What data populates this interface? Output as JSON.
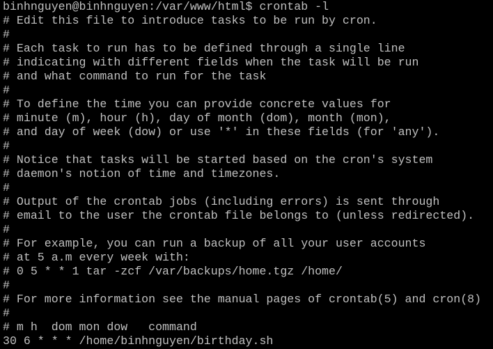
{
  "colors": {
    "background": "#000000",
    "text": "#c0c0c0"
  },
  "terminal": {
    "prompt": "binhnguyen@binhnguyen:/var/www/html$",
    "command": "crontab -l",
    "lines": [
      "# Edit this file to introduce tasks to be run by cron.",
      "#",
      "# Each task to run has to be defined through a single line",
      "# indicating with different fields when the task will be run",
      "# and what command to run for the task",
      "#",
      "# To define the time you can provide concrete values for",
      "# minute (m), hour (h), day of month (dom), month (mon),",
      "# and day of week (dow) or use '*' in these fields (for 'any').",
      "#",
      "# Notice that tasks will be started based on the cron's system",
      "# daemon's notion of time and timezones.",
      "#",
      "# Output of the crontab jobs (including errors) is sent through",
      "# email to the user the crontab file belongs to (unless redirected).",
      "#",
      "# For example, you can run a backup of all your user accounts",
      "# at 5 a.m every week with:",
      "# 0 5 * * 1 tar -zcf /var/backups/home.tgz /home/",
      "#",
      "# For more information see the manual pages of crontab(5) and cron(8)",
      "#",
      "# m h  dom mon dow   command",
      "30 6 * * * /home/binhnguyen/birthday.sh"
    ]
  }
}
